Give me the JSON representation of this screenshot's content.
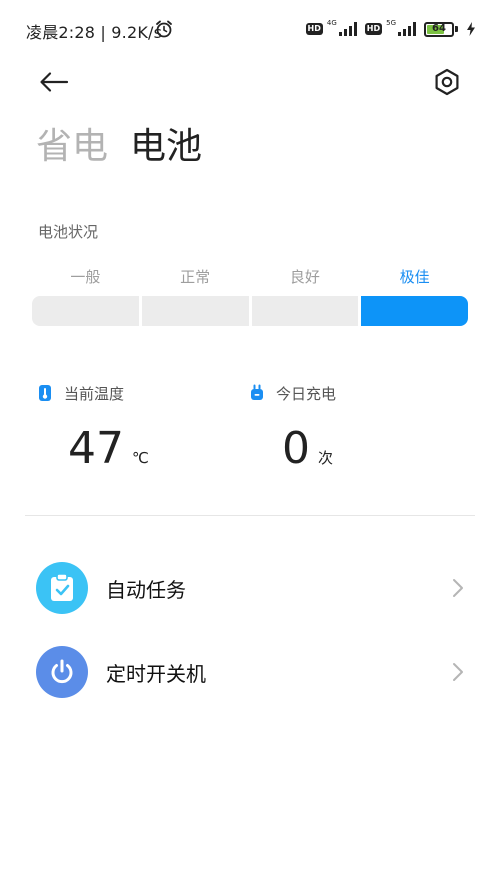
{
  "status_bar": {
    "time_speed": "凌晨2:28 | 9.2K/s",
    "hd_label": "HD",
    "network_1": "4G",
    "network_2": "5G",
    "battery_percent": "64",
    "battery_level": 0.64,
    "battery_color": "#7cc243"
  },
  "header": {
    "tabs": [
      {
        "label": "省电",
        "active": false
      },
      {
        "label": "电池",
        "active": true
      }
    ]
  },
  "battery_status": {
    "title": "电池状况",
    "levels": [
      {
        "label": "一般",
        "active": false
      },
      {
        "label": "正常",
        "active": false
      },
      {
        "label": "良好",
        "active": false
      },
      {
        "label": "极佳",
        "active": true
      }
    ],
    "active_color": "#0d94f8"
  },
  "stats": {
    "temperature": {
      "title": "当前温度",
      "value": "47",
      "unit": "℃",
      "icon": "thermometer-icon"
    },
    "charges": {
      "title": "今日充电",
      "value": "0",
      "unit": "次",
      "icon": "charger-plug-icon"
    }
  },
  "list": [
    {
      "label": "自动任务",
      "icon": "clipboard-check-icon",
      "color": "#3bc3f5"
    },
    {
      "label": "定时开关机",
      "icon": "power-icon",
      "color": "#5b8de8"
    }
  ]
}
